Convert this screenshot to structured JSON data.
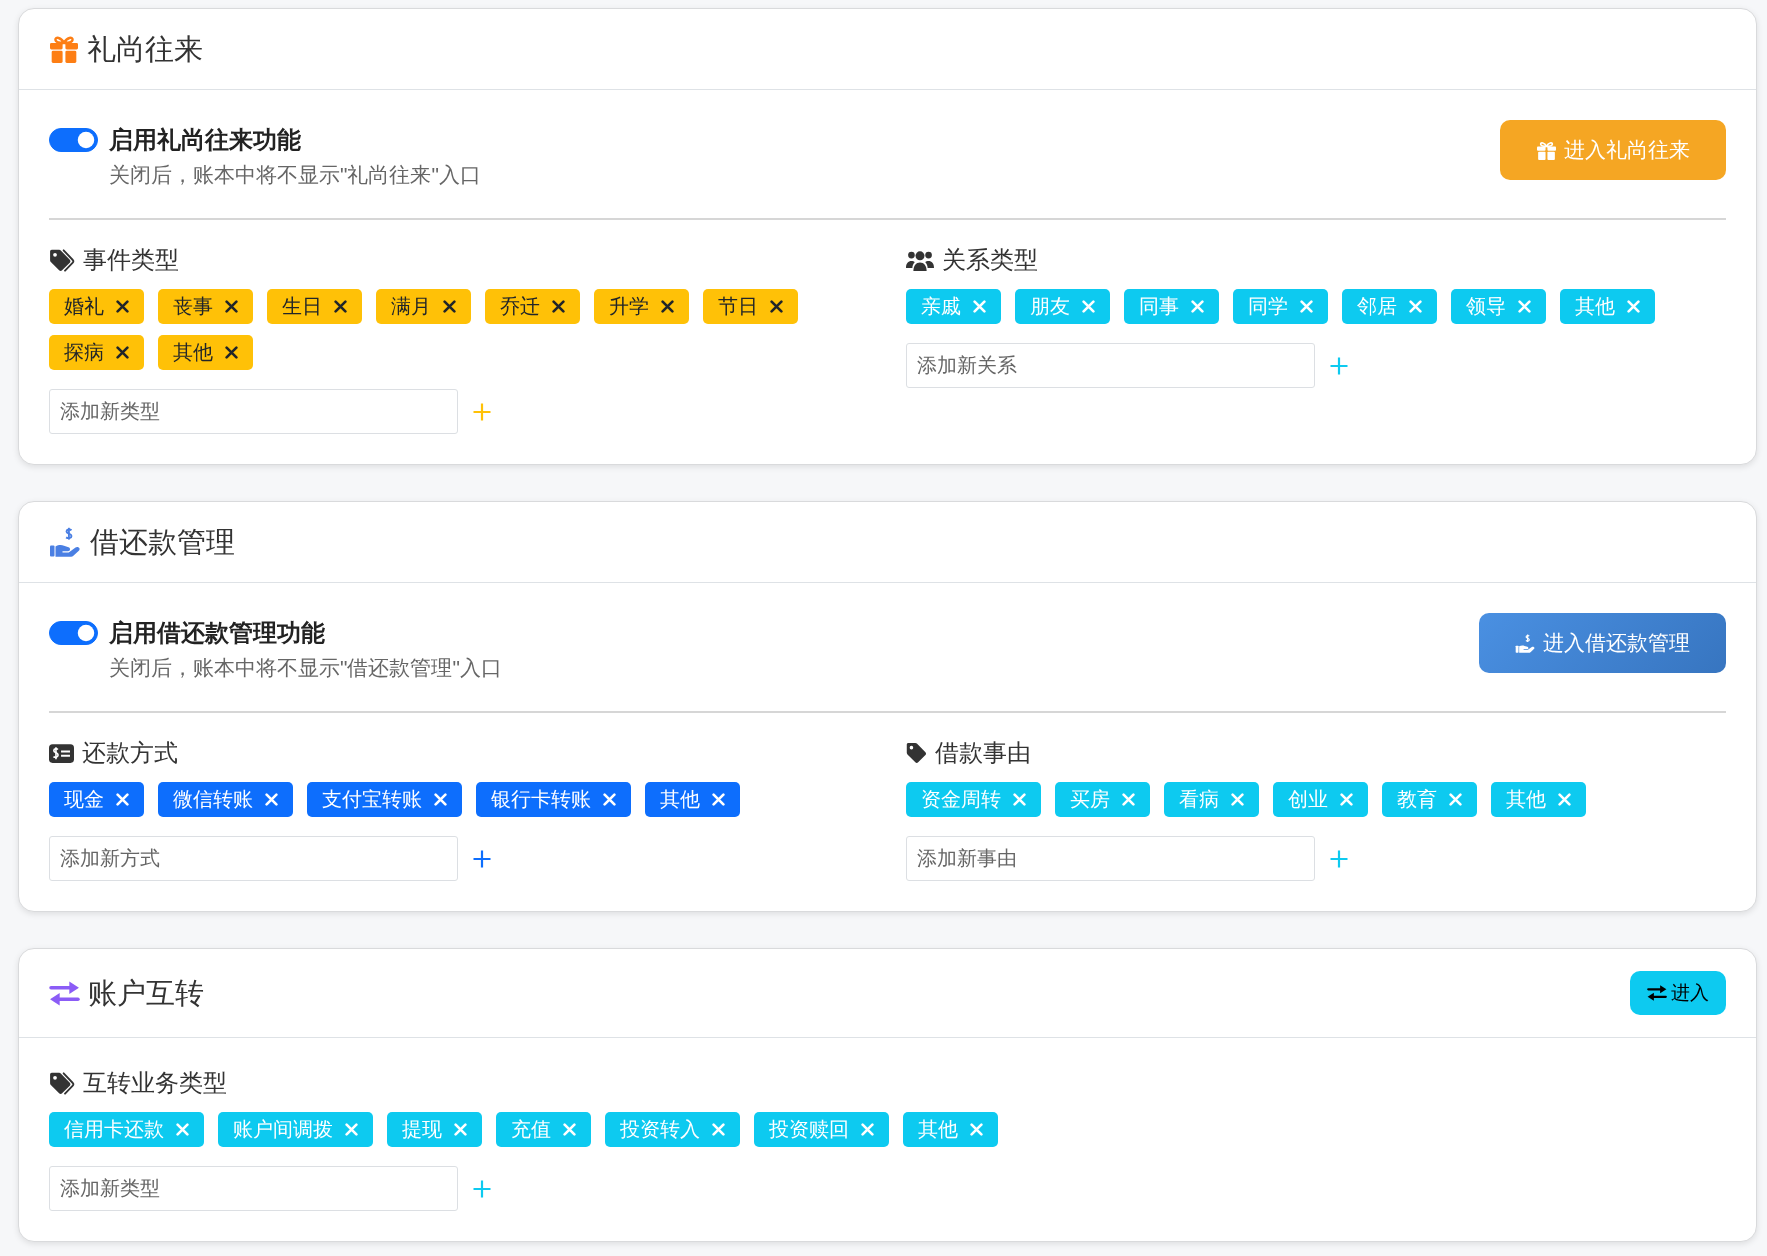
{
  "cards": [
    {
      "kind": "gifts",
      "title": "礼尚往来",
      "feature": {
        "label": "启用礼尚往来功能",
        "enabled": true,
        "description": "关闭后，账本中将不显示\"礼尚往来\"入口",
        "button": "进入礼尚往来"
      },
      "groups": [
        {
          "kind": "event",
          "title": "事件类型",
          "color": "#ffc107",
          "tags": [
            "婚礼",
            "丧事",
            "生日",
            "满月",
            "乔迁",
            "升学",
            "节日",
            "探病",
            "其他"
          ],
          "placeholder": "添加新类型"
        },
        {
          "kind": "relation",
          "title": "关系类型",
          "color": "#0dcaf0",
          "tags": [
            "亲戚",
            "朋友",
            "同事",
            "同学",
            "邻居",
            "领导",
            "其他"
          ],
          "placeholder": "添加新关系"
        }
      ]
    },
    {
      "kind": "loans",
      "title": "借还款管理",
      "feature": {
        "label": "启用借还款管理功能",
        "enabled": true,
        "description": "关闭后，账本中将不显示\"借还款管理\"入口",
        "button": "进入借还款管理"
      },
      "groups": [
        {
          "kind": "method",
          "title": "还款方式",
          "color": "#0d6efd",
          "tags": [
            "现金",
            "微信转账",
            "支付宝转账",
            "银行卡转账",
            "其他"
          ],
          "placeholder": "添加新方式"
        },
        {
          "kind": "reason",
          "title": "借款事由",
          "color": "#0dcaf0",
          "tags": [
            "资金周转",
            "买房",
            "看病",
            "创业",
            "教育",
            "其他"
          ],
          "placeholder": "添加新事由"
        }
      ]
    },
    {
      "kind": "transfers",
      "title": "账户互转",
      "header_button": "进入",
      "groups": [
        {
          "kind": "transfer",
          "title": "互转业务类型",
          "color": "#0dcaf0",
          "tags": [
            "信用卡还款",
            "账户间调拨",
            "提现",
            "充值",
            "投资转入",
            "投资赎回",
            "其他"
          ],
          "placeholder": "添加新类型"
        }
      ]
    }
  ]
}
